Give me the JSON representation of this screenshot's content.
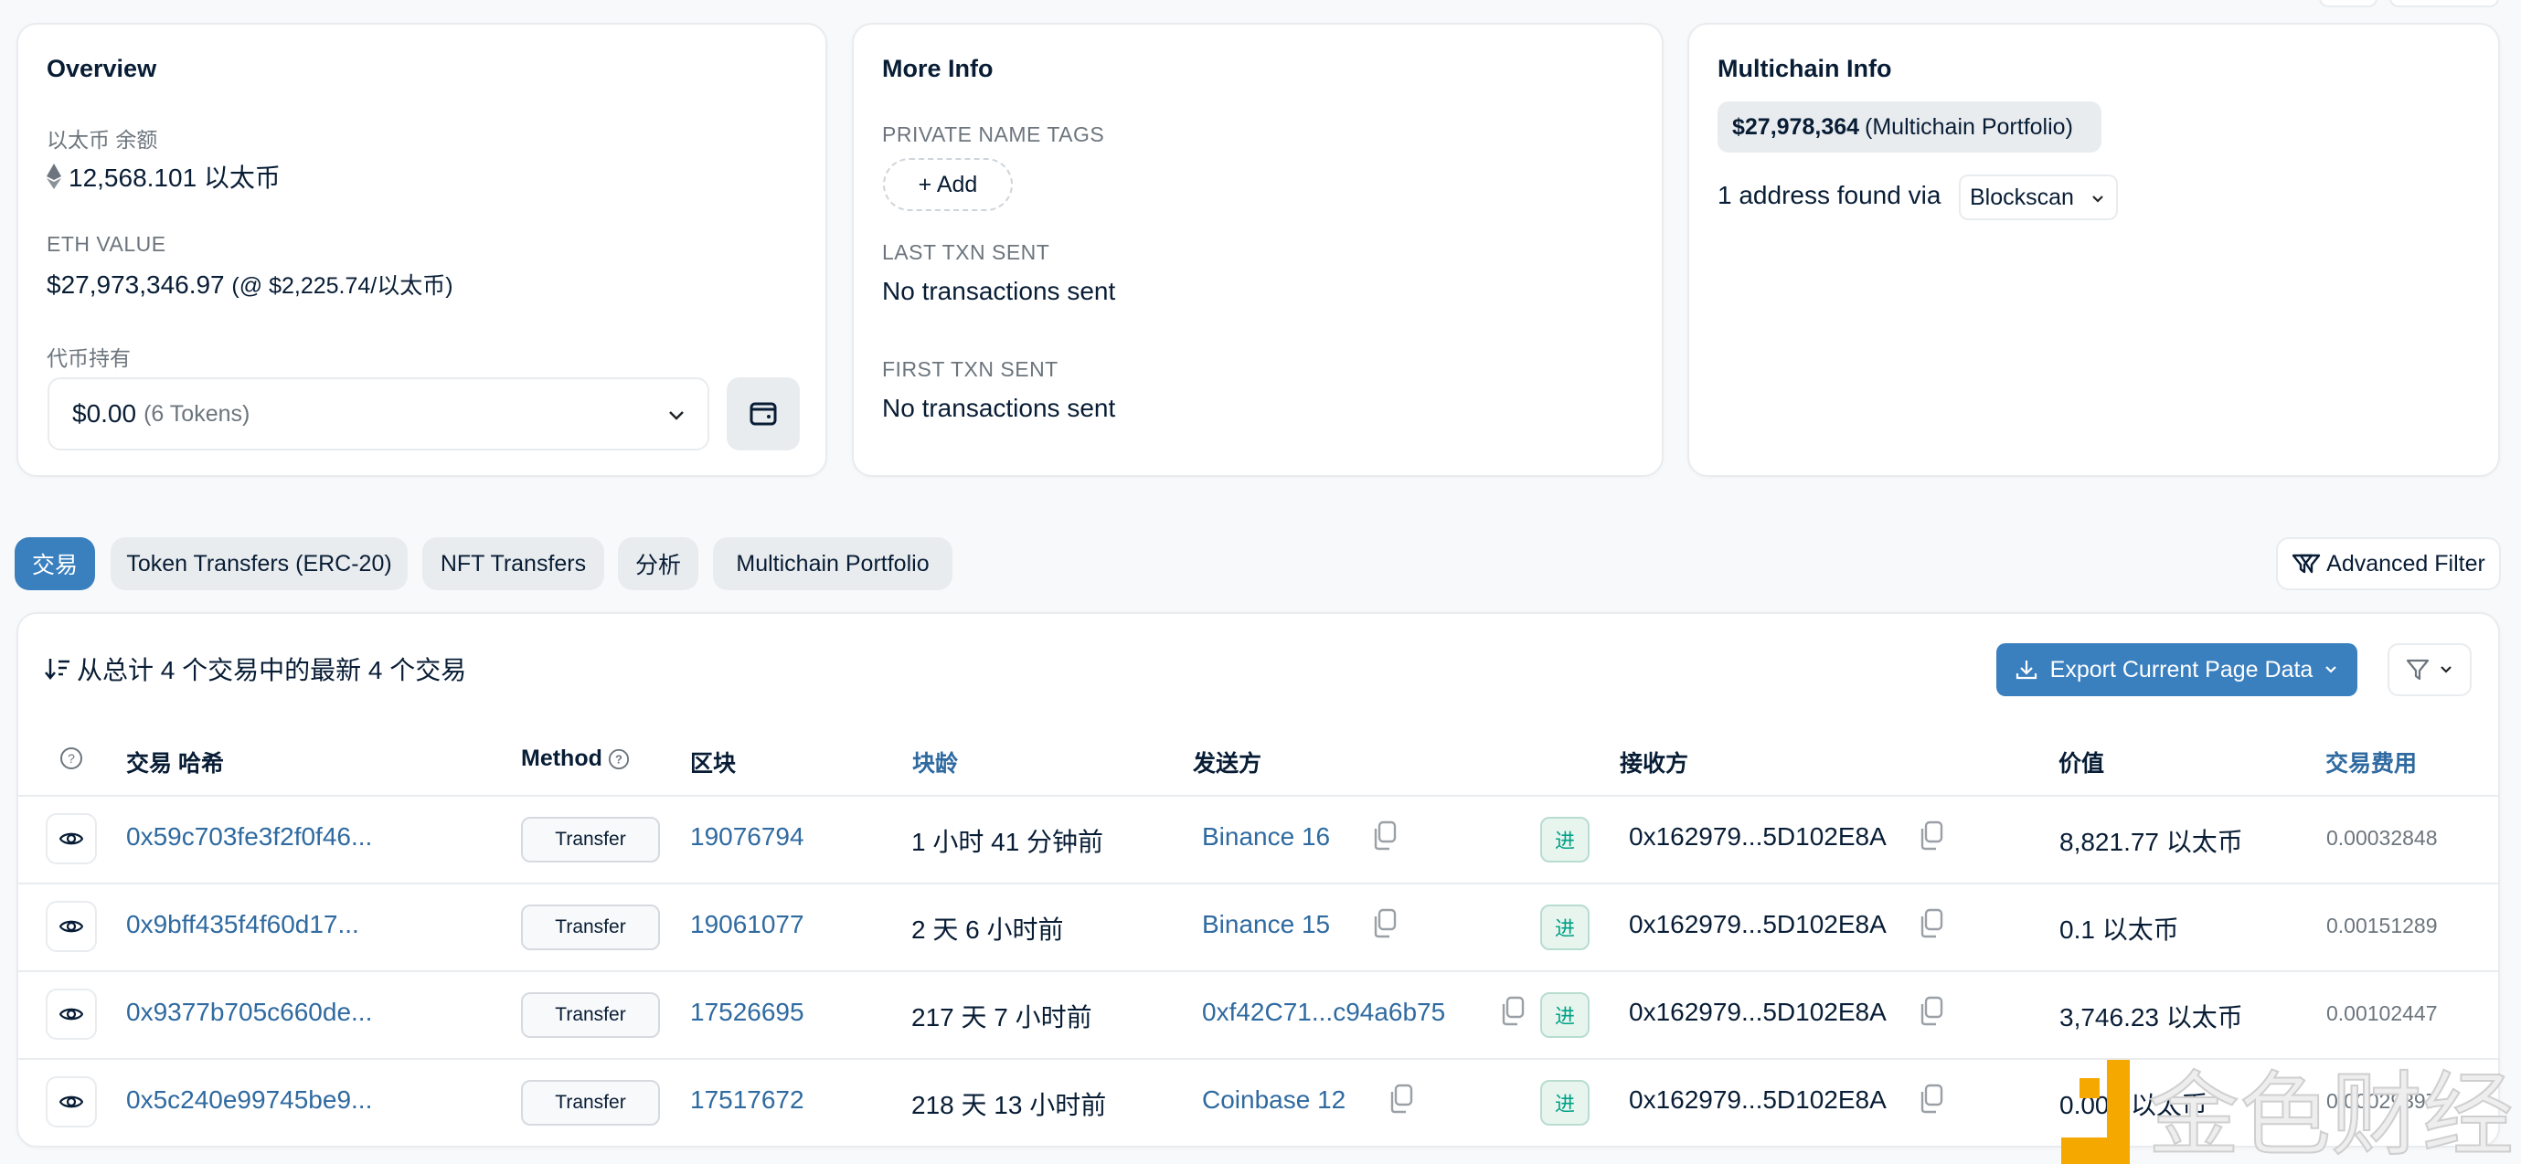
{
  "overview": {
    "title": "Overview",
    "eth_balance_label": "以太币 余额",
    "eth_balance_value": "12,568.101 以太币",
    "eth_value_label": "ETH VALUE",
    "eth_value_amount": "$27,973,346.97",
    "eth_value_rate": "(@ $2,225.74/以太币)",
    "token_holdings_label": "代币持有",
    "token_holdings_value": "$0.00",
    "token_holdings_count": "(6 Tokens)"
  },
  "more_info": {
    "title": "More Info",
    "private_name_tags_label": "PRIVATE NAME TAGS",
    "add_button": "+ Add",
    "last_txn_label": "LAST TXN SENT",
    "last_txn_value": "No transactions sent",
    "first_txn_label": "FIRST TXN SENT",
    "first_txn_value": "No transactions sent"
  },
  "multichain": {
    "title": "Multichain Info",
    "portfolio_amount": "$27,978,364",
    "portfolio_label": "(Multichain Portfolio)",
    "address_found_text": "1 address found via",
    "source_dropdown": "Blockscan"
  },
  "tabs": [
    {
      "label": "交易",
      "active": true
    },
    {
      "label": "Token Transfers (ERC-20)",
      "active": false
    },
    {
      "label": "NFT Transfers",
      "active": false
    },
    {
      "label": "分析",
      "active": false
    },
    {
      "label": "Multichain Portfolio",
      "active": false
    }
  ],
  "advanced_filter": "Advanced Filter",
  "table": {
    "summary": "从总计 4 个交易中的最新 4 个交易",
    "export_button": "Export Current Page Data",
    "columns": {
      "hash": "交易 哈希",
      "method": "Method",
      "block": "区块",
      "age": "块龄",
      "from": "发送方",
      "to": "接收方",
      "value": "价值",
      "fee": "交易费用"
    },
    "rows": [
      {
        "hash": "0x59c703fe3f2f0f46...",
        "method": "Transfer",
        "block": "19076794",
        "age": "1 小时 41 分钟前",
        "from": "Binance 16",
        "direction": "进",
        "to": "0x162979...5D102E8A",
        "value": "8,821.77 以太币",
        "fee": "0.00032848"
      },
      {
        "hash": "0x9bff435f4f60d17...",
        "method": "Transfer",
        "block": "19061077",
        "age": "2 天 6 小时前",
        "from": "Binance 15",
        "direction": "进",
        "to": "0x162979...5D102E8A",
        "value": "0.1 以太币",
        "fee": "0.00151289"
      },
      {
        "hash": "0x9377b705c660de...",
        "method": "Transfer",
        "block": "17526695",
        "age": "217 天 7 小时前",
        "from": "0xf42C71...c94a6b75",
        "direction": "进",
        "to": "0x162979...5D102E8A",
        "value": "3,746.23 以太币",
        "fee": "0.00102447"
      },
      {
        "hash": "0x5c240e99745be9...",
        "method": "Transfer",
        "block": "17517672",
        "age": "218 天 13 小时前",
        "from": "Coinbase 12",
        "direction": "进",
        "to": "0x162979...5D102E8A",
        "value": "0.001 以太币",
        "fee": "0.00029397"
      }
    ]
  },
  "watermark": "金色财经",
  "colors": {
    "accent": "#3a7fbe",
    "link": "#2f6aa0",
    "in_badge": "#00a186",
    "watermark_orange": "#f5a800"
  }
}
